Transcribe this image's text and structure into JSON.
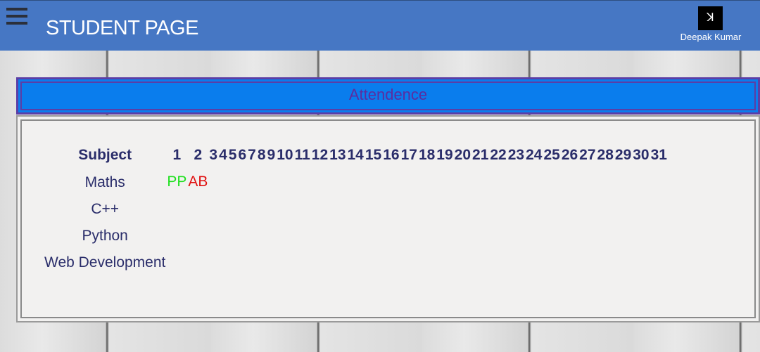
{
  "header": {
    "title": "STUDENT PAGE",
    "user_name": "Deepak Kumar",
    "menu_icon": "hamburger-icon"
  },
  "banner": {
    "title": "Attendence"
  },
  "table": {
    "subject_header": "Subject",
    "days": [
      "1",
      "2",
      "3",
      "4",
      "5",
      "6",
      "7",
      "8",
      "9",
      "10",
      "11",
      "12",
      "13",
      "14",
      "15",
      "16",
      "17",
      "18",
      "19",
      "20",
      "21",
      "22",
      "23",
      "24",
      "25",
      "26",
      "27",
      "28",
      "29",
      "30",
      "31"
    ],
    "rows": [
      {
        "subject": "Maths",
        "marks": [
          "PP",
          "AB"
        ]
      },
      {
        "subject": "C++",
        "marks": []
      },
      {
        "subject": "Python",
        "marks": []
      },
      {
        "subject": "Web Development",
        "marks": []
      }
    ]
  },
  "colors": {
    "header": "#4677c4",
    "banner": "#0a7ded",
    "present": "#1ee01e",
    "absent": "#e01010",
    "text": "#2a2d6a"
  }
}
